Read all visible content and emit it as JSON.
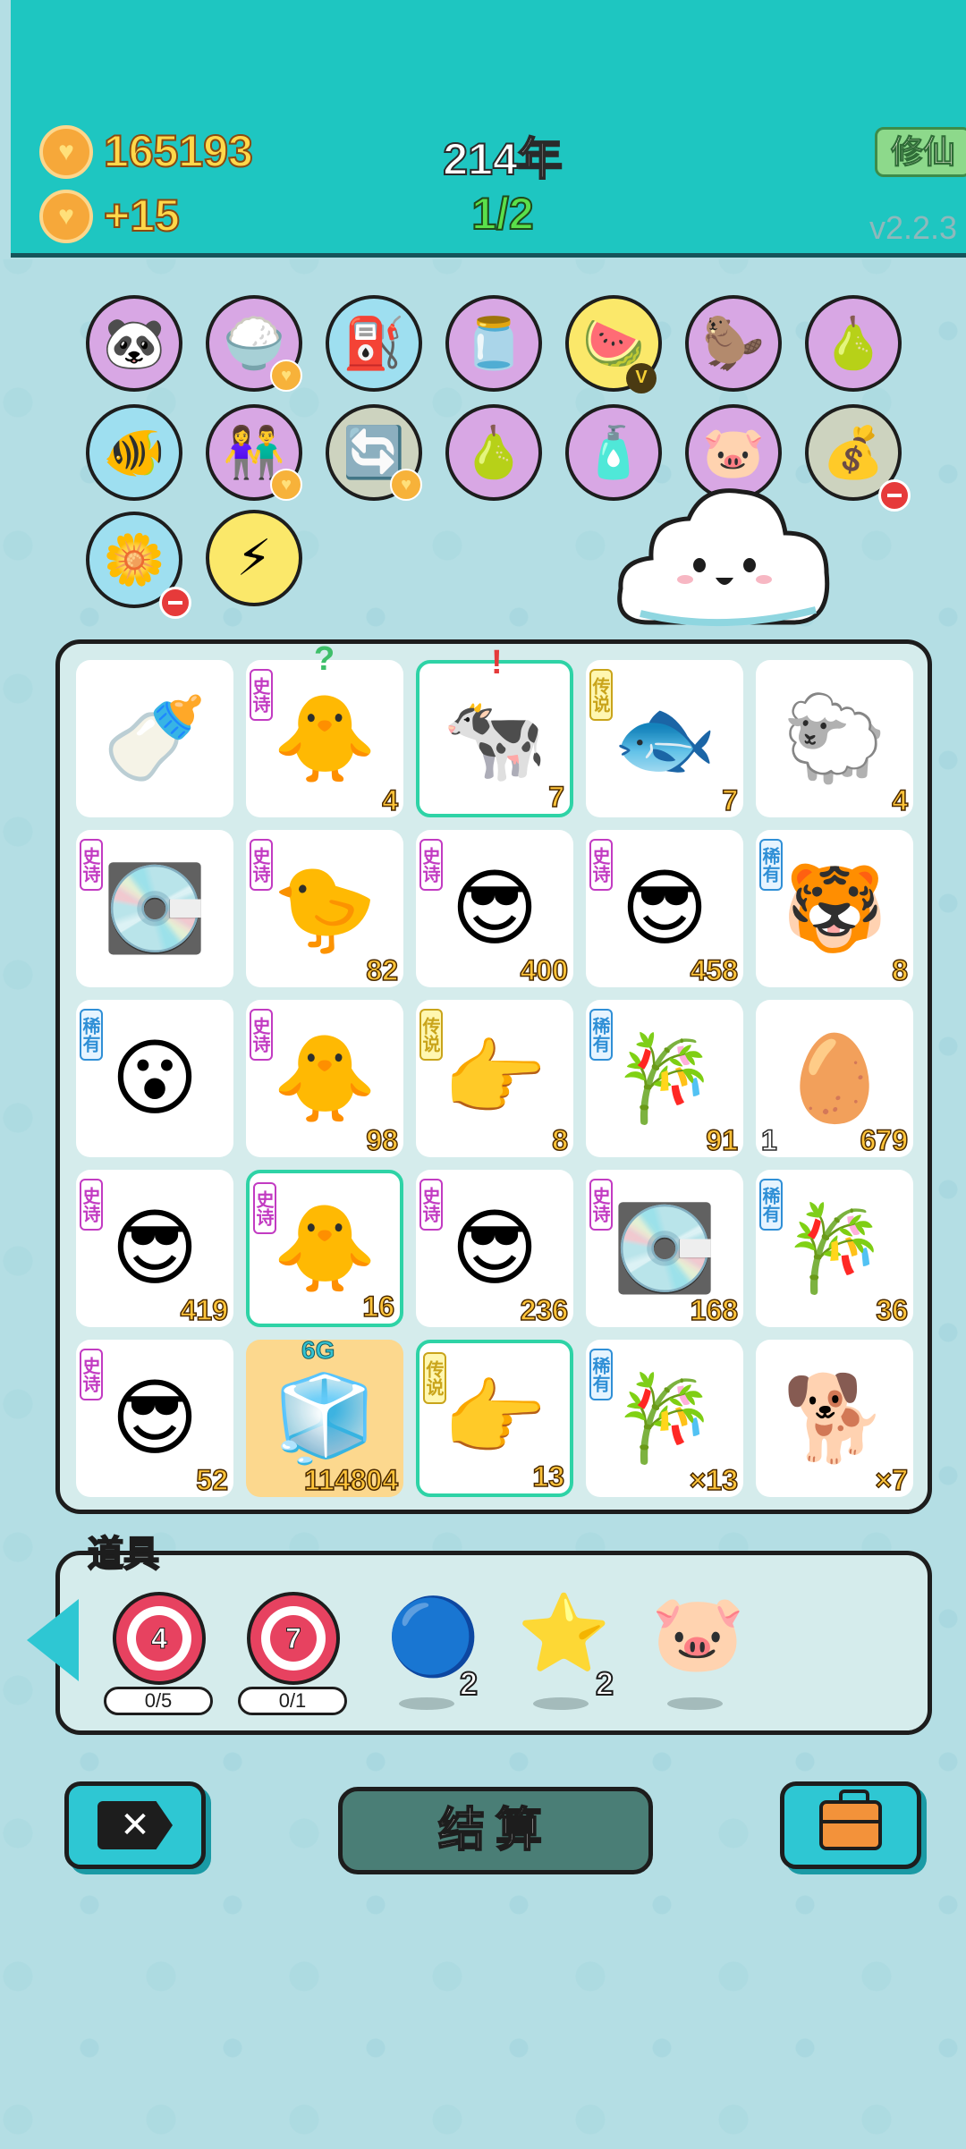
{
  "header": {
    "coins": "165193",
    "income": "+15",
    "year": "214年",
    "round": "1/2",
    "xiuxian_label": "修仙",
    "version": "v2.2.3"
  },
  "relics": [
    {
      "icon": "panda-icon",
      "glyph": "🐼",
      "color": "purple"
    },
    {
      "icon": "rice-bowl-icon",
      "glyph": "🍚",
      "color": "purple",
      "badge": "heart"
    },
    {
      "icon": "air-pump-icon",
      "glyph": "⛽",
      "color": "blue"
    },
    {
      "icon": "jar-icon",
      "glyph": "🫙",
      "color": "purple"
    },
    {
      "icon": "fruit-platter-icon",
      "glyph": "🍉",
      "color": "yellow",
      "badge": "v"
    },
    {
      "icon": "meerkats-icon",
      "glyph": "🦫",
      "color": "purple"
    },
    {
      "icon": "eyepatch-pear-icon",
      "glyph": "🍐",
      "color": "purple"
    },
    {
      "icon": "fishbowl-icon",
      "glyph": "🐠",
      "color": "blue"
    },
    {
      "icon": "couple-icon",
      "glyph": "👫",
      "color": "purple",
      "badge": "heart"
    },
    {
      "icon": "refresh-icon",
      "glyph": "🔄",
      "color": "grey",
      "badge": "heart"
    },
    {
      "icon": "eyepatch-pear-icon",
      "glyph": "🍐",
      "color": "purple"
    },
    {
      "icon": "spray-bottle-icon",
      "glyph": "🧴",
      "color": "purple"
    },
    {
      "icon": "piggy-bank-icon",
      "glyph": "🐷",
      "color": "purple"
    },
    {
      "icon": "sack-icon",
      "glyph": "💰",
      "color": "grey",
      "badge": "minus"
    },
    {
      "icon": "flower-pot-icon",
      "glyph": "🌼",
      "color": "blue",
      "badge": "minus"
    },
    {
      "icon": "lightning-icon",
      "glyph": "⚡",
      "color": "yellow"
    }
  ],
  "board": [
    {
      "icon": "milk-bottle-icon",
      "glyph": "🍼",
      "num": "",
      "tag": ""
    },
    {
      "icon": "old-chick-icon",
      "glyph": "🐥",
      "num": "4",
      "tag": "史诗",
      "tag_type": "epic",
      "mark": "?"
    },
    {
      "icon": "cow-icon",
      "glyph": "🐄",
      "num": "7",
      "tag": "",
      "sel": true,
      "mark": "!"
    },
    {
      "icon": "koi-icon",
      "glyph": "🐟",
      "num": "7",
      "tag": "传说",
      "tag_type": "legend"
    },
    {
      "icon": "sheep-icon",
      "glyph": "🐑",
      "num": "4",
      "tag": ""
    },
    {
      "icon": "gpu-icon",
      "glyph": "💽",
      "num": "",
      "tag": "史诗",
      "tag_type": "epic"
    },
    {
      "icon": "yellow-chick-icon",
      "glyph": "🐤",
      "num": "82",
      "tag": "史诗",
      "tag_type": "epic"
    },
    {
      "icon": "green-hat-man-icon",
      "glyph": "😎",
      "num": "400",
      "tag": "史诗",
      "tag_type": "epic"
    },
    {
      "icon": "green-hat-basketball-icon",
      "glyph": "😎",
      "num": "458",
      "tag": "史诗",
      "tag_type": "epic"
    },
    {
      "icon": "tiger-icon",
      "glyph": "🐯",
      "num": "8",
      "tag": "稀有",
      "tag_type": "rare"
    },
    {
      "icon": "shocked-man-icon",
      "glyph": "😮",
      "num": "",
      "tag": "稀有",
      "tag_type": "rare"
    },
    {
      "icon": "old-chick-basketball-icon",
      "glyph": "🐥",
      "num": "98",
      "tag": "史诗",
      "tag_type": "epic"
    },
    {
      "icon": "pointing-hand-icon",
      "glyph": "👉",
      "num": "8",
      "tag": "传说",
      "tag_type": "legend"
    },
    {
      "icon": "bamboo-icon",
      "glyph": "🎋",
      "num": "91",
      "tag": "稀有",
      "tag_type": "rare"
    },
    {
      "icon": "egg-icon",
      "glyph": "🥚",
      "num": "679",
      "left": "1",
      "tag": ""
    },
    {
      "icon": "green-hat-man-icon",
      "glyph": "😎",
      "num": "419",
      "tag": "史诗",
      "tag_type": "epic"
    },
    {
      "icon": "old-chick-icon",
      "glyph": "🐥",
      "num": "16",
      "tag": "史诗",
      "tag_type": "epic",
      "sel": true
    },
    {
      "icon": "green-hat-basketball-icon",
      "glyph": "😎",
      "num": "236",
      "tag": "史诗",
      "tag_type": "epic"
    },
    {
      "icon": "gpu-basketball-icon",
      "glyph": "💽",
      "num": "168",
      "tag": "史诗",
      "tag_type": "epic"
    },
    {
      "icon": "bamboo-basketball-icon",
      "glyph": "🎋",
      "num": "36",
      "tag": "稀有",
      "tag_type": "rare"
    },
    {
      "icon": "green-hat-man-icon",
      "glyph": "😎",
      "num": "52",
      "tag": "史诗",
      "tag_type": "epic"
    },
    {
      "icon": "fridge-icon",
      "glyph": "🧊",
      "num": "114804",
      "tag": "",
      "gold": true,
      "mark": "6G"
    },
    {
      "icon": "pointing-hand-basketball-icon",
      "glyph": "👉",
      "num": "13",
      "tag": "传说",
      "tag_type": "legend",
      "sel": true
    },
    {
      "icon": "bamboo-icon",
      "glyph": "🎋",
      "num": "×13",
      "tag": "稀有",
      "tag_type": "rare"
    },
    {
      "icon": "husky-icon",
      "glyph": "🐕",
      "num": "×7",
      "tag": ""
    }
  ],
  "items": {
    "title": "道具",
    "target1": {
      "value": "4",
      "uses": "0/5"
    },
    "target2": {
      "value": "7",
      "uses": "0/1"
    },
    "blue_orb_count": "2",
    "star_count": "2"
  },
  "buttons": {
    "settle": "结算"
  },
  "colors": {
    "header_bg": "#1ec6c1",
    "board_bg": "#d5ecec",
    "number": "#ffc43a",
    "epic": "#c23bc2",
    "legend": "#c9a41a",
    "rare": "#2f8fd6"
  }
}
